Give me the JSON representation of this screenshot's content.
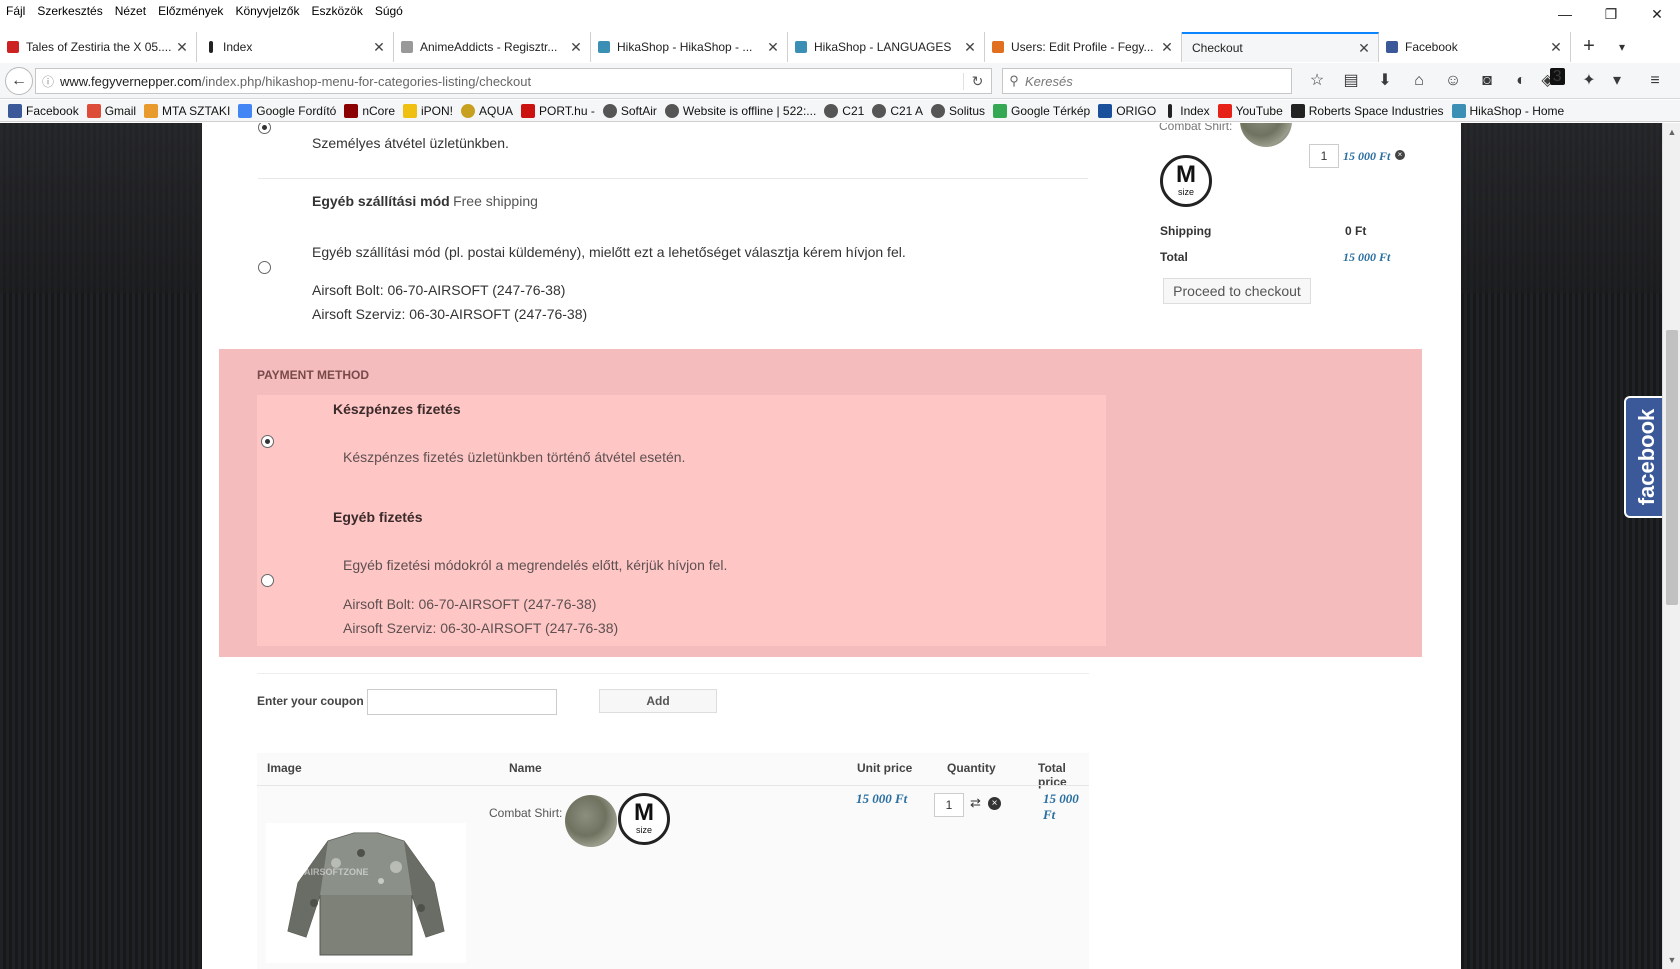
{
  "menu": [
    "Fájl",
    "Szerkesztés",
    "Nézet",
    "Előzmények",
    "Könyvjelzők",
    "Eszközök",
    "Súgó"
  ],
  "tabs": [
    {
      "label": "Tales of Zestiria the X 05....",
      "color": "#cc2222"
    },
    {
      "label": "Index",
      "color": "#222222"
    },
    {
      "label": "AnimeAddicts - Regisztr...",
      "color": "#888888"
    },
    {
      "label": "HikaShop - HikaShop - ...",
      "color": "#3b8fb5"
    },
    {
      "label": "HikaShop - LANGUAGES",
      "color": "#3b8fb5"
    },
    {
      "label": "Users: Edit Profile - Fegy...",
      "color": "#e07020"
    },
    {
      "label": "Checkout",
      "color": "#f5f6f7"
    },
    {
      "label": "Facebook",
      "color": "#3b5998"
    }
  ],
  "url": {
    "domain": "www.fegyvernepper.com",
    "path": "/index.php/hikashop-menu-for-categories-listing/checkout"
  },
  "search": {
    "placeholder": "Keresés"
  },
  "toolbar": {
    "badge": "3"
  },
  "bookmarks": [
    {
      "label": "Facebook",
      "color": "#3b5998"
    },
    {
      "label": "Gmail",
      "color": "#dd4b39"
    },
    {
      "label": "MTA SZTAKI",
      "color": "#e89a2c"
    },
    {
      "label": "Google Fordító",
      "color": "#4285f4"
    },
    {
      "label": "nCore",
      "color": "#8b0000"
    },
    {
      "label": "iPON!",
      "color": "#f0c010"
    },
    {
      "label": "AQUA",
      "color": "#c8a020"
    },
    {
      "label": "PORT.hu -",
      "color": "#cc1111"
    },
    {
      "label": "SoftAir",
      "color": "#555555"
    },
    {
      "label": "Website is offline | 522:...",
      "color": "#555555"
    },
    {
      "label": "C21",
      "color": "#555555"
    },
    {
      "label": "C21 A",
      "color": "#555555"
    },
    {
      "label": "Solitus",
      "color": "#555555"
    },
    {
      "label": "Google Térkép",
      "color": "#34a853"
    },
    {
      "label": "ORIGO",
      "color": "#1a4f9c"
    },
    {
      "label": "Index",
      "color": "#222222"
    },
    {
      "label": "YouTube",
      "color": "#e62117"
    },
    {
      "label": "Roberts Space Industries",
      "color": "#222222"
    },
    {
      "label": "HikaShop - Home",
      "color": "#3b8fb5"
    }
  ],
  "shipping": {
    "option1_text": "Személyes átvétel üzletünkben.",
    "option2_title": "Egyéb szállítási mód",
    "option2_price": "Free shipping",
    "option2_desc": "Egyéb szállítási mód (pl. postai küldemény), mielőtt ezt a lehetőséget választja kérem hívjon fel.",
    "option2_phone1": "Airsoft Bolt: 06-70-AIRSOFT (247-76-38)",
    "option2_phone2": "Airsoft Szerviz: 06-30-AIRSOFT (247-76-38)"
  },
  "payment": {
    "title": "PAYMENT METHOD",
    "option1_title": "Készpénzes fizetés",
    "option1_desc": "Készpénzes fizetés üzletünkben történő átvétel esetén.",
    "option2_title": "Egyéb fizetés",
    "option2_desc": "Egyéb fizetési módokról a megrendelés előtt, kérjük hívjon fel.",
    "option2_phone1": "Airsoft Bolt: 06-70-AIRSOFT (247-76-38)",
    "option2_phone2": "Airsoft Szerviz: 06-30-AIRSOFT (247-76-38)"
  },
  "coupon": {
    "label": "Enter your coupon",
    "button": "Add"
  },
  "cart_table": {
    "headers": [
      "Image",
      "Name",
      "Unit price",
      "Quantity",
      "Total price"
    ],
    "row": {
      "name": "Combat Shirt:",
      "size": "M",
      "size_label": "size",
      "unit_price": "15 000 Ft",
      "quantity": "1",
      "total_price": "15 000 Ft",
      "watermark": "AIRSOFTZONE"
    }
  },
  "side_cart": {
    "item_label": "Combat Shirt:",
    "quantity": "1",
    "item_price": "15 000 Ft",
    "shipping_label": "Shipping",
    "shipping_value": "0 Ft",
    "total_label": "Total",
    "total_value": "15 000 Ft",
    "checkout_button": "Proceed to checkout",
    "size": "M",
    "size_label": "size"
  },
  "fb_widget": "facebook"
}
